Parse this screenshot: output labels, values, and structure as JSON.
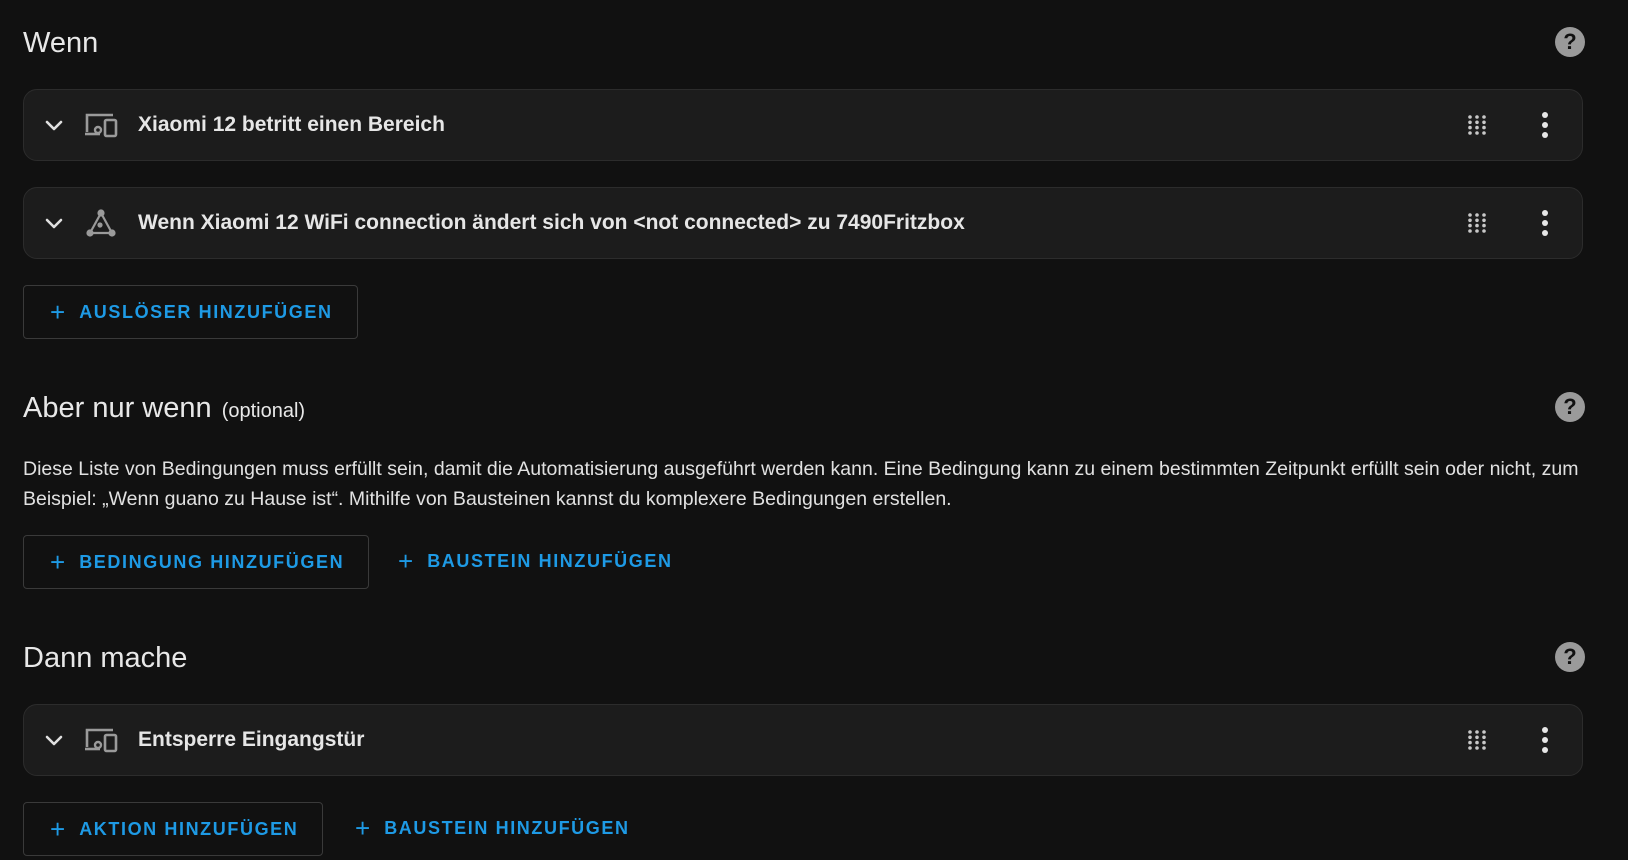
{
  "triggers": {
    "title": "Wenn",
    "items": [
      {
        "label": "Xiaomi 12 betritt einen Bereich",
        "icon": "device-icon"
      },
      {
        "label": "Wenn Xiaomi 12 WiFi connection ändert sich von <not connected> zu 7490Fritzbox",
        "icon": "state-graph-icon"
      }
    ],
    "add_label": "AUSLÖSER HINZUFÜGEN"
  },
  "conditions": {
    "title": "Aber nur wenn",
    "optional": "(optional)",
    "description": "Diese Liste von Bedingungen muss erfüllt sein, damit die Automatisierung ausgeführt werden kann. Eine Bedingung kann zu einem bestimmten Zeitpunkt erfüllt sein oder nicht, zum Beispiel: „Wenn guano zu Hause ist“. Mithilfe von Bausteinen kannst du komplexere Bedingungen erstellen.",
    "add_label": "BEDINGUNG HINZUFÜGEN",
    "add_block_label": "BAUSTEIN HINZUFÜGEN"
  },
  "actions": {
    "title": "Dann mache",
    "items": [
      {
        "label": "Entsperre Eingangstür",
        "icon": "device-icon"
      }
    ],
    "add_label": "AKTION HINZUFÜGEN",
    "add_block_label": "BAUSTEIN HINZUFÜGEN"
  },
  "plus_symbol": "+",
  "help_symbol": "?",
  "colors": {
    "background": "#111111",
    "card": "#1c1c1c",
    "accent": "#1e9ae5",
    "icon": "#9a9a9a",
    "text": "#e1e1e1"
  }
}
